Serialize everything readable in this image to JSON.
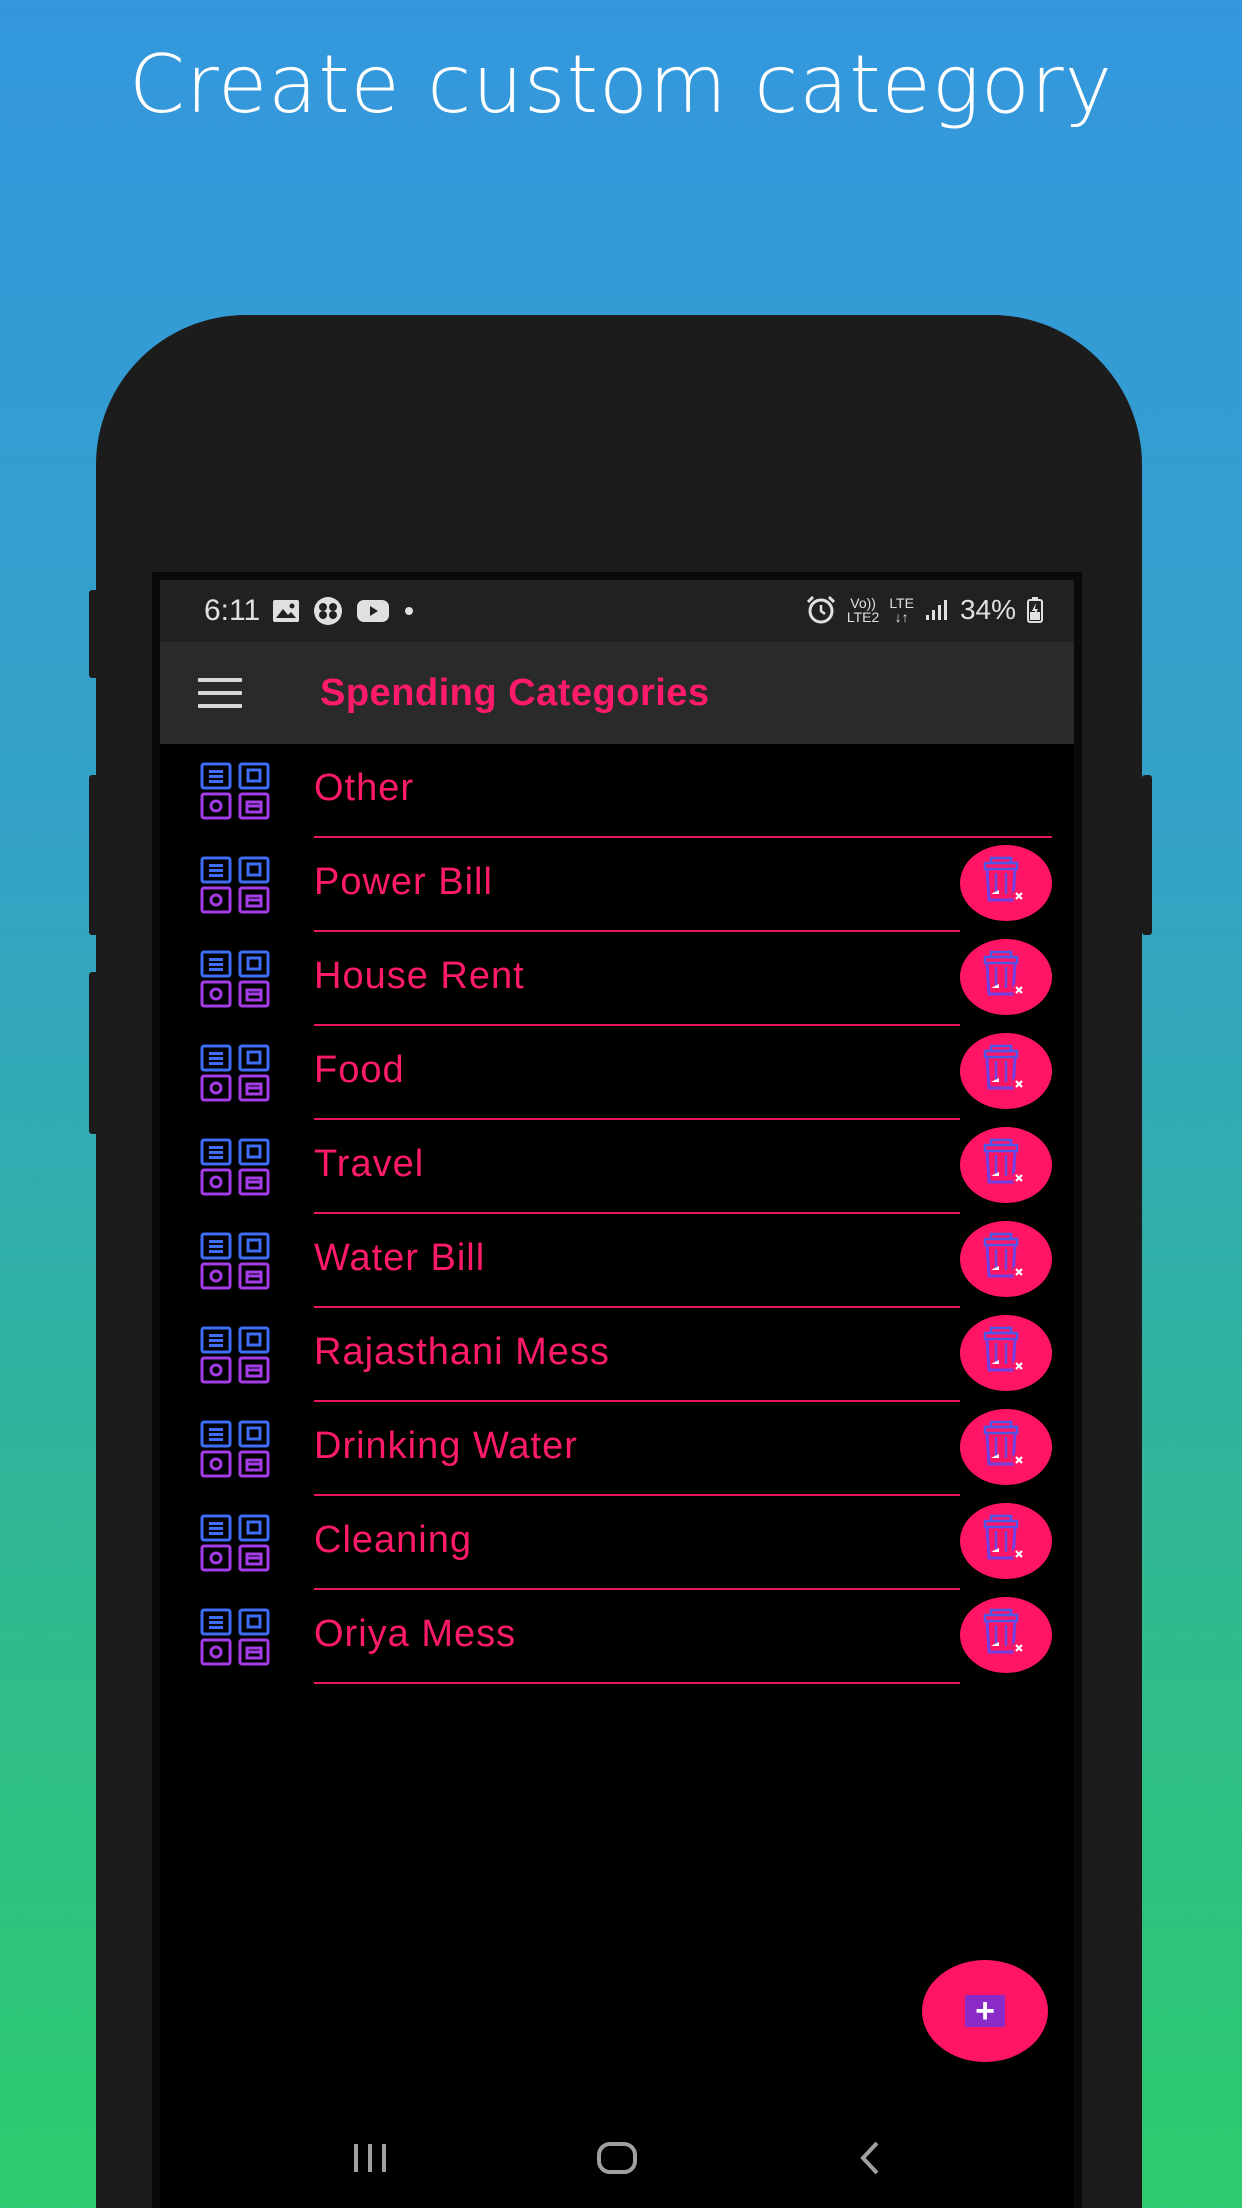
{
  "headline": "Create custom category",
  "status_bar": {
    "time": "6:11",
    "left_icons": [
      "image-icon",
      "app-icon",
      "youtube-icon",
      "dot-icon"
    ],
    "network_volte": "Vo))",
    "network_lte2": "LTE2",
    "network_lte": "LTE",
    "battery": "34%"
  },
  "app_bar": {
    "title": "Spending Categories"
  },
  "categories": [
    {
      "label": "Other",
      "deletable": false
    },
    {
      "label": "Power Bill",
      "deletable": true
    },
    {
      "label": "House Rent",
      "deletable": true
    },
    {
      "label": "Food",
      "deletable": true
    },
    {
      "label": "Travel",
      "deletable": true
    },
    {
      "label": "Water Bill",
      "deletable": true
    },
    {
      "label": "Rajasthani Mess",
      "deletable": true
    },
    {
      "label": "Drinking Water",
      "deletable": true
    },
    {
      "label": "Cleaning",
      "deletable": true
    },
    {
      "label": "Oriya Mess",
      "deletable": true
    }
  ],
  "fab": {
    "icon": "plus-icon",
    "symbol": "+"
  },
  "nav": {
    "recents_icon": "recents-icon",
    "home_icon": "home-icon",
    "back_icon": "back-icon"
  },
  "colors": {
    "accent": "#ff1a6b",
    "divider": "#e8175e",
    "icon_blue": "#3f6df5",
    "icon_purple": "#a43ce8"
  }
}
